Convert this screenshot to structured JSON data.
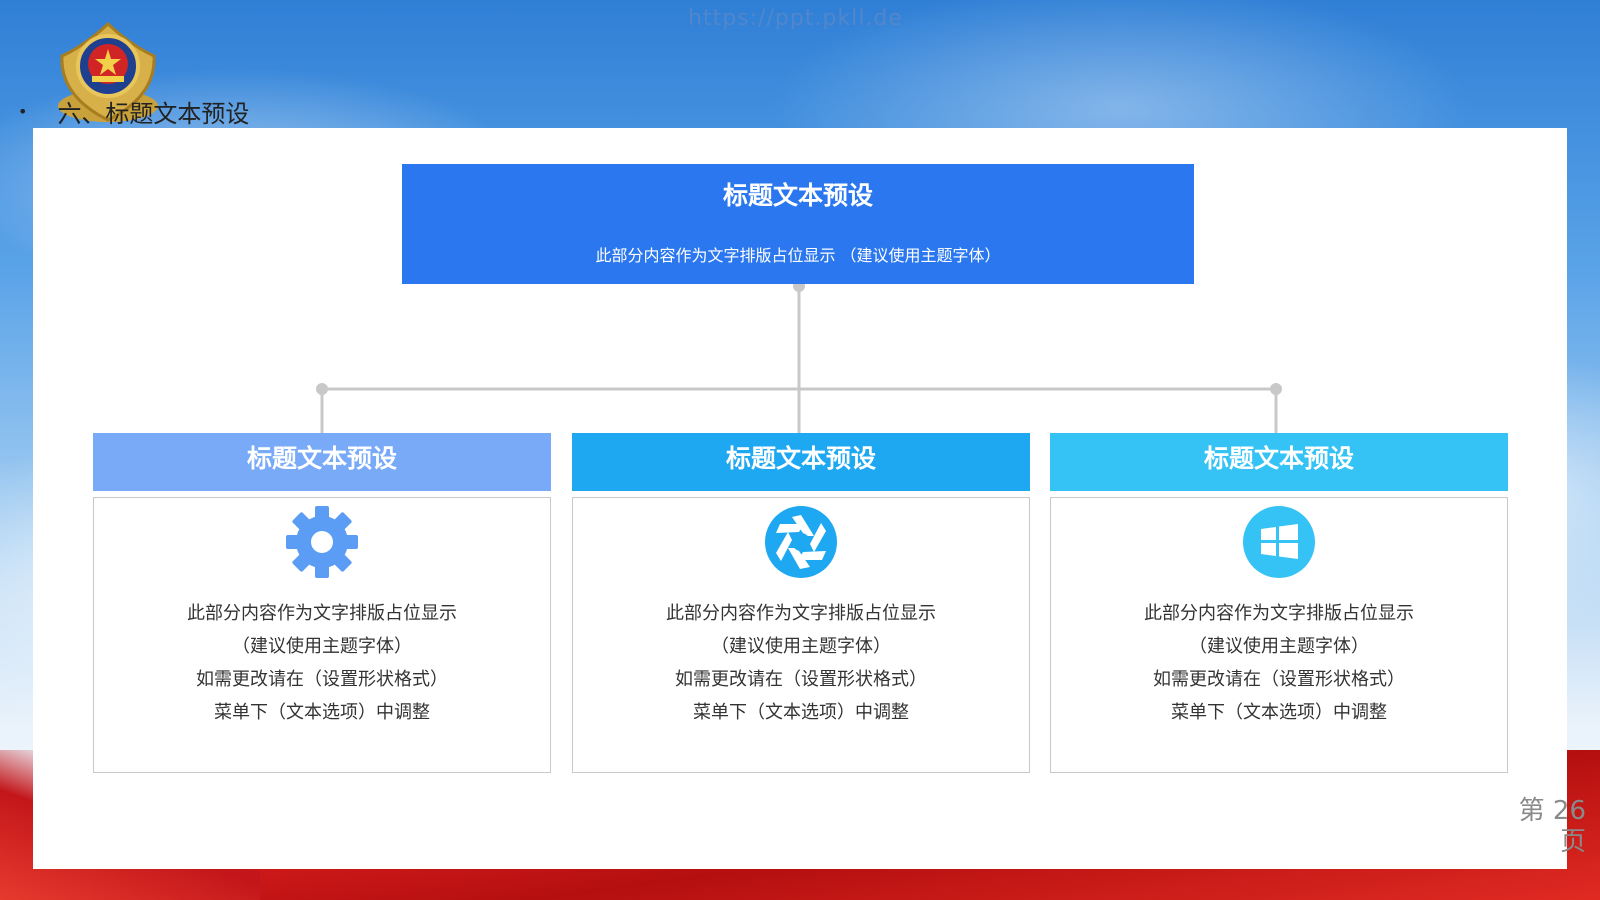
{
  "watermark": "https://ppt.pkll.de",
  "slide_title": {
    "bullet": "•",
    "text": "六、标题文本预设"
  },
  "top_box": {
    "title": "标题文本预设",
    "subtitle": "此部分内容作为文字排版占位显示 （建议使用主题字体）"
  },
  "columns": [
    {
      "header": "标题文本预设",
      "header_color": "#78aaf7",
      "icon": "gear-icon",
      "icon_color": "#5b9cf5",
      "lines": [
        "此部分内容作为文字排版占位显示",
        "（建议使用主题字体）",
        "如需更改请在（设置形状格式）",
        "菜单下（文本选项）中调整"
      ]
    },
    {
      "header": "标题文本预设",
      "header_color": "#1ea8f2",
      "icon": "camera-aperture-icon",
      "icon_color": "#1ea8f2",
      "lines": [
        "此部分内容作为文字排版占位显示",
        "（建议使用主题字体）",
        "如需更改请在（设置形状格式）",
        "菜单下（文本选项）中调整"
      ]
    },
    {
      "header": "标题文本预设",
      "header_color": "#35c3f5",
      "icon": "windows-logo-icon",
      "icon_color": "#35c3f5",
      "lines": [
        "此部分内容作为文字排版占位显示",
        "（建议使用主题字体）",
        "如需更改请在（设置形状格式）",
        "菜单下（文本选项）中调整"
      ]
    }
  ],
  "page_number": {
    "line1": "第 26",
    "line2": "页"
  },
  "colors": {
    "top_box": "#2a77ef",
    "connector": "#c8c8c8"
  }
}
